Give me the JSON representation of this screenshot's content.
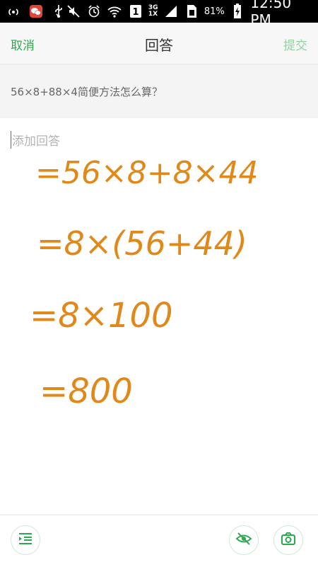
{
  "status_bar": {
    "battery_percent": "81%",
    "time": "12:50 PM",
    "network_top": "3G",
    "network_bottom": "1X",
    "sim_badge": "1"
  },
  "header": {
    "cancel_label": "取消",
    "title": "回答",
    "submit_label": "提交"
  },
  "question": {
    "text": "56×8+88×4简便方法怎么算？"
  },
  "answer": {
    "placeholder": "添加回答",
    "handwriting_lines": [
      "=56×8+8×44",
      "=8×(56+44)",
      "=8×100",
      "=800"
    ]
  },
  "toolbar": {
    "icons": [
      "format-list-icon",
      "eye-icon",
      "camera-icon"
    ]
  },
  "colors": {
    "accent_green": "#2fa84f",
    "submit_green_light": "#8fd3a0",
    "handwriting_orange": "#e0891a"
  }
}
